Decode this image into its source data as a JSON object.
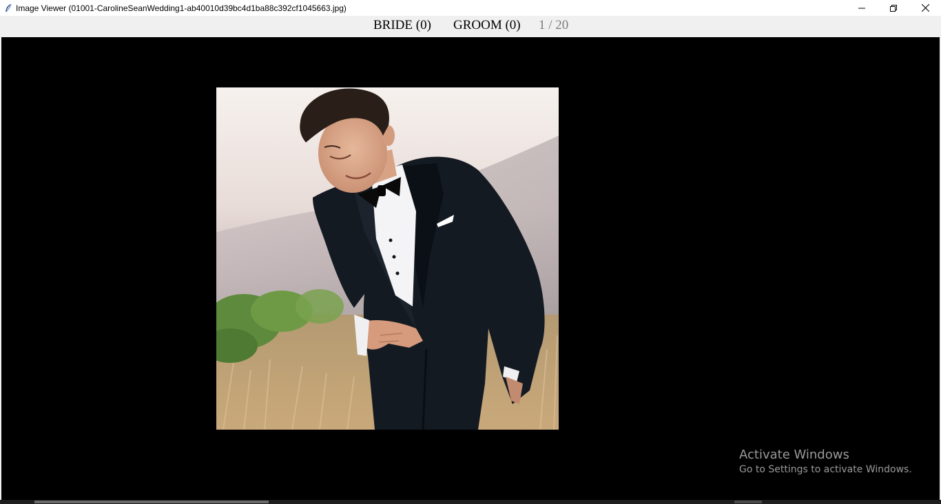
{
  "window": {
    "title": "Image Viewer (01001-CarolineSeanWedding1-ab40010d39bc4d1ba88c392cf1045663.jpg)",
    "icon": "feather-icon",
    "controls": [
      "minimize-icon",
      "restore-icon",
      "close-icon"
    ]
  },
  "toolbar": {
    "bride_label": "BRIDE (0)",
    "groom_label": "GROOM (0)",
    "counter": "1 / 20"
  },
  "viewer": {
    "background": "#000000",
    "image_alt": "Groom in black tuxedo with bow tie, outdoors"
  },
  "watermark": {
    "title": "Activate Windows",
    "subtitle": "Go to Settings to activate Windows."
  }
}
